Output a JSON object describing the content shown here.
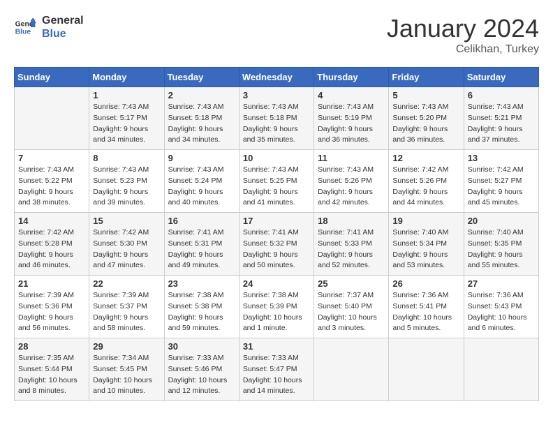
{
  "header": {
    "logo_line1": "General",
    "logo_line2": "Blue",
    "month": "January 2024",
    "location": "Celikhan, Turkey"
  },
  "days_of_week": [
    "Sunday",
    "Monday",
    "Tuesday",
    "Wednesday",
    "Thursday",
    "Friday",
    "Saturday"
  ],
  "weeks": [
    [
      {
        "day": "",
        "info": ""
      },
      {
        "day": "1",
        "info": "Sunrise: 7:43 AM\nSunset: 5:17 PM\nDaylight: 9 hours\nand 34 minutes."
      },
      {
        "day": "2",
        "info": "Sunrise: 7:43 AM\nSunset: 5:18 PM\nDaylight: 9 hours\nand 34 minutes."
      },
      {
        "day": "3",
        "info": "Sunrise: 7:43 AM\nSunset: 5:18 PM\nDaylight: 9 hours\nand 35 minutes."
      },
      {
        "day": "4",
        "info": "Sunrise: 7:43 AM\nSunset: 5:19 PM\nDaylight: 9 hours\nand 36 minutes."
      },
      {
        "day": "5",
        "info": "Sunrise: 7:43 AM\nSunset: 5:20 PM\nDaylight: 9 hours\nand 36 minutes."
      },
      {
        "day": "6",
        "info": "Sunrise: 7:43 AM\nSunset: 5:21 PM\nDaylight: 9 hours\nand 37 minutes."
      }
    ],
    [
      {
        "day": "7",
        "info": "Sunrise: 7:43 AM\nSunset: 5:22 PM\nDaylight: 9 hours\nand 38 minutes."
      },
      {
        "day": "8",
        "info": "Sunrise: 7:43 AM\nSunset: 5:23 PM\nDaylight: 9 hours\nand 39 minutes."
      },
      {
        "day": "9",
        "info": "Sunrise: 7:43 AM\nSunset: 5:24 PM\nDaylight: 9 hours\nand 40 minutes."
      },
      {
        "day": "10",
        "info": "Sunrise: 7:43 AM\nSunset: 5:25 PM\nDaylight: 9 hours\nand 41 minutes."
      },
      {
        "day": "11",
        "info": "Sunrise: 7:43 AM\nSunset: 5:26 PM\nDaylight: 9 hours\nand 42 minutes."
      },
      {
        "day": "12",
        "info": "Sunrise: 7:42 AM\nSunset: 5:26 PM\nDaylight: 9 hours\nand 44 minutes."
      },
      {
        "day": "13",
        "info": "Sunrise: 7:42 AM\nSunset: 5:27 PM\nDaylight: 9 hours\nand 45 minutes."
      }
    ],
    [
      {
        "day": "14",
        "info": "Sunrise: 7:42 AM\nSunset: 5:28 PM\nDaylight: 9 hours\nand 46 minutes."
      },
      {
        "day": "15",
        "info": "Sunrise: 7:42 AM\nSunset: 5:30 PM\nDaylight: 9 hours\nand 47 minutes."
      },
      {
        "day": "16",
        "info": "Sunrise: 7:41 AM\nSunset: 5:31 PM\nDaylight: 9 hours\nand 49 minutes."
      },
      {
        "day": "17",
        "info": "Sunrise: 7:41 AM\nSunset: 5:32 PM\nDaylight: 9 hours\nand 50 minutes."
      },
      {
        "day": "18",
        "info": "Sunrise: 7:41 AM\nSunset: 5:33 PM\nDaylight: 9 hours\nand 52 minutes."
      },
      {
        "day": "19",
        "info": "Sunrise: 7:40 AM\nSunset: 5:34 PM\nDaylight: 9 hours\nand 53 minutes."
      },
      {
        "day": "20",
        "info": "Sunrise: 7:40 AM\nSunset: 5:35 PM\nDaylight: 9 hours\nand 55 minutes."
      }
    ],
    [
      {
        "day": "21",
        "info": "Sunrise: 7:39 AM\nSunset: 5:36 PM\nDaylight: 9 hours\nand 56 minutes."
      },
      {
        "day": "22",
        "info": "Sunrise: 7:39 AM\nSunset: 5:37 PM\nDaylight: 9 hours\nand 58 minutes."
      },
      {
        "day": "23",
        "info": "Sunrise: 7:38 AM\nSunset: 5:38 PM\nDaylight: 9 hours\nand 59 minutes."
      },
      {
        "day": "24",
        "info": "Sunrise: 7:38 AM\nSunset: 5:39 PM\nDaylight: 10 hours\nand 1 minute."
      },
      {
        "day": "25",
        "info": "Sunrise: 7:37 AM\nSunset: 5:40 PM\nDaylight: 10 hours\nand 3 minutes."
      },
      {
        "day": "26",
        "info": "Sunrise: 7:36 AM\nSunset: 5:41 PM\nDaylight: 10 hours\nand 5 minutes."
      },
      {
        "day": "27",
        "info": "Sunrise: 7:36 AM\nSunset: 5:43 PM\nDaylight: 10 hours\nand 6 minutes."
      }
    ],
    [
      {
        "day": "28",
        "info": "Sunrise: 7:35 AM\nSunset: 5:44 PM\nDaylight: 10 hours\nand 8 minutes."
      },
      {
        "day": "29",
        "info": "Sunrise: 7:34 AM\nSunset: 5:45 PM\nDaylight: 10 hours\nand 10 minutes."
      },
      {
        "day": "30",
        "info": "Sunrise: 7:33 AM\nSunset: 5:46 PM\nDaylight: 10 hours\nand 12 minutes."
      },
      {
        "day": "31",
        "info": "Sunrise: 7:33 AM\nSunset: 5:47 PM\nDaylight: 10 hours\nand 14 minutes."
      },
      {
        "day": "",
        "info": ""
      },
      {
        "day": "",
        "info": ""
      },
      {
        "day": "",
        "info": ""
      }
    ]
  ]
}
